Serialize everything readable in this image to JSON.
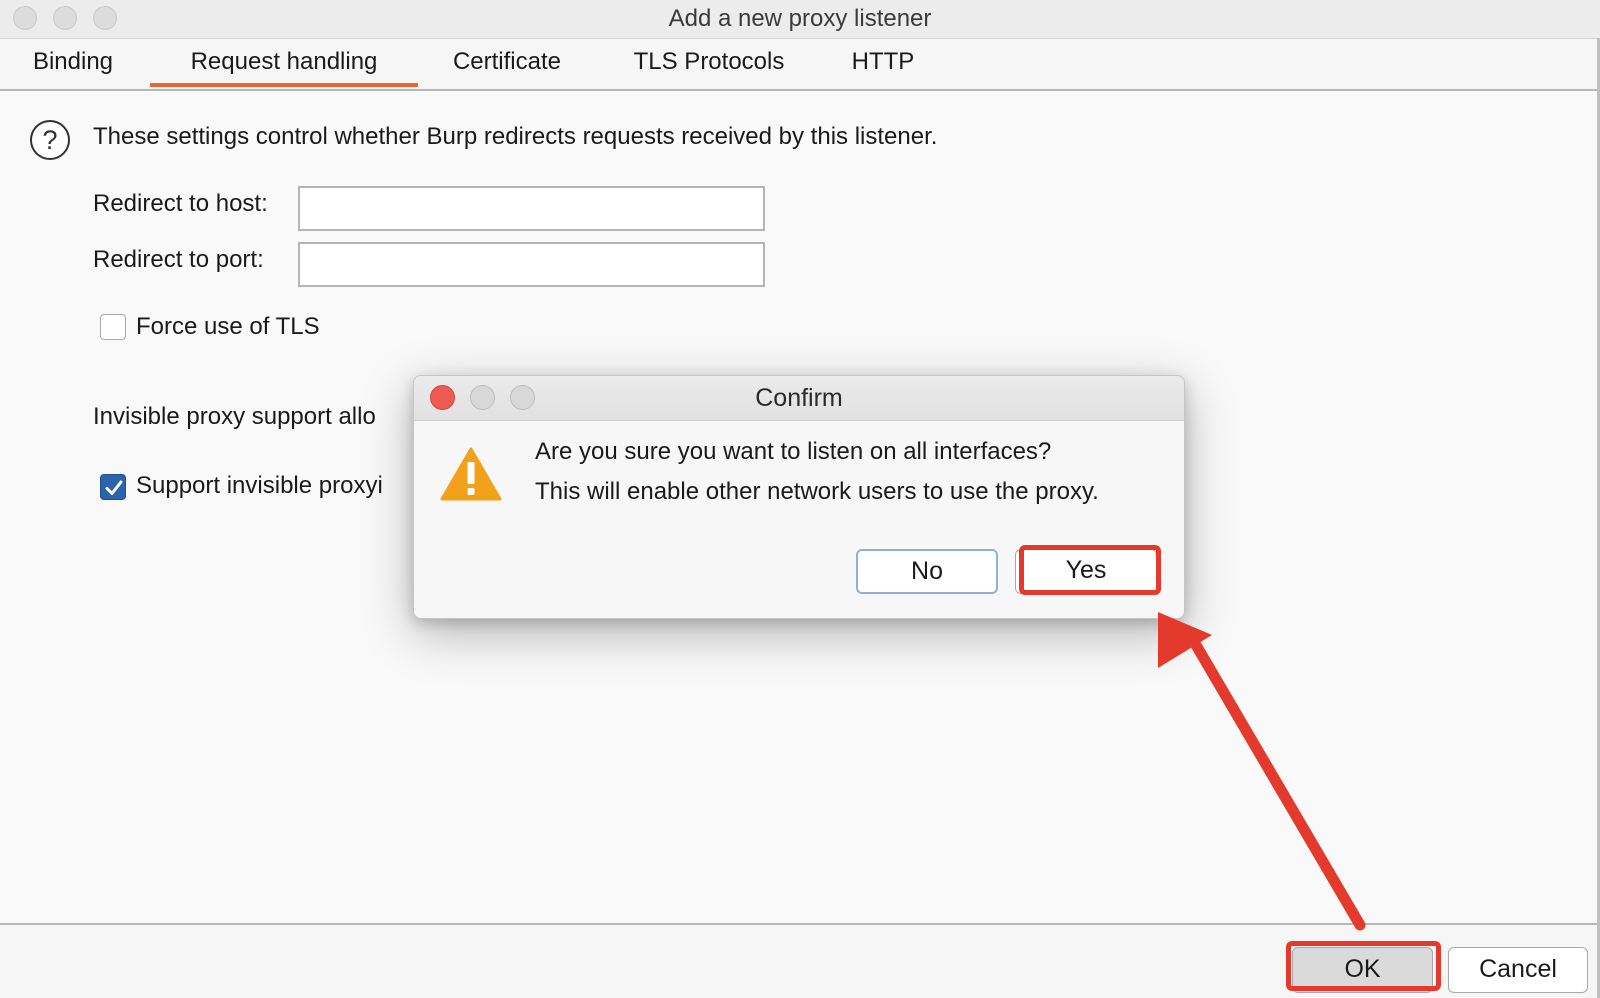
{
  "window": {
    "title": "Add a new proxy listener"
  },
  "tabs": [
    {
      "label": "Binding",
      "active": false
    },
    {
      "label": "Request handling",
      "active": true
    },
    {
      "label": "Certificate",
      "active": false
    },
    {
      "label": "TLS Protocols",
      "active": false
    },
    {
      "label": "HTTP",
      "active": false
    }
  ],
  "request_handling": {
    "intro": "These settings control whether Burp redirects requests received by this listener.",
    "redirect_host_label": "Redirect to host:",
    "redirect_host_value": "",
    "redirect_port_label": "Redirect to port:",
    "redirect_port_value": "",
    "force_tls_label": "Force use of TLS",
    "force_tls_checked": false,
    "invisible_text_partial": "Invisible proxy support allo",
    "support_invisible_label_partial": "Support invisible proxyi",
    "support_invisible_checked": true
  },
  "footer": {
    "ok_label": "OK",
    "cancel_label": "Cancel"
  },
  "confirm_dialog": {
    "title": "Confirm",
    "message_line1": "Are you sure you want to listen on all interfaces?",
    "message_line2": "This will enable other network users to use the proxy.",
    "no_label": "No",
    "yes_label": "Yes"
  },
  "icons": {
    "help": "question-circle-icon",
    "warning": "warning-triangle-icon",
    "check": "checkmark-icon"
  },
  "colors": {
    "tab_accent": "#e8662f",
    "annotation_red": "#e33a2d",
    "checkbox_blue": "#2d62ac",
    "warning_orange": "#f2a21a",
    "close_button_red": "#ee5b52"
  }
}
